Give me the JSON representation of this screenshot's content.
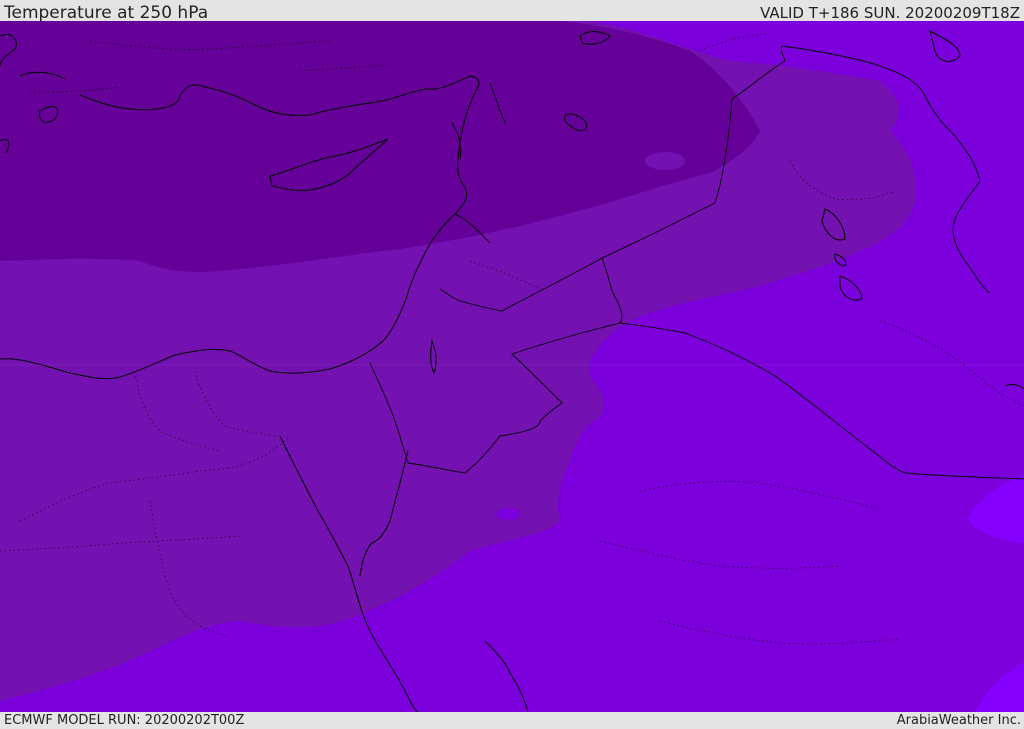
{
  "header": {
    "title": "Temperature at 250 hPa",
    "valid": "VALID T+186 SUN. 20200209T18Z"
  },
  "footer": {
    "model_run": "ECMWF MODEL RUN: 20200202T00Z",
    "credit": "ArabiaWeather Inc."
  },
  "colors": {
    "band_coldest": "#650099",
    "band_cold": "#7411b1",
    "band_mid": "#7c00dc",
    "band_warm": "#8500ff",
    "boundaries": "#000000"
  }
}
